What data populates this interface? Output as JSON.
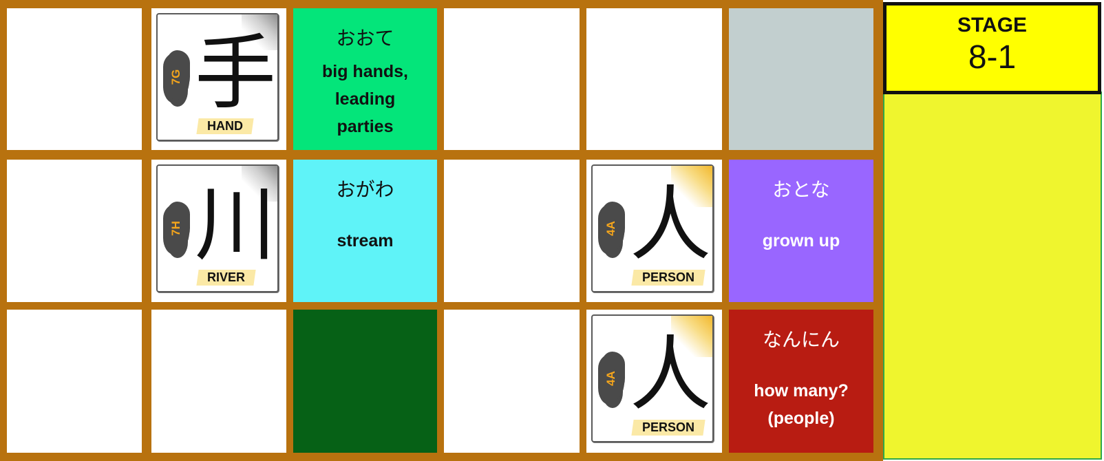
{
  "board": {
    "kanji_tiles": [
      {
        "glyph": "手",
        "code": "7G",
        "label": "HAND",
        "shine": "gray"
      },
      {
        "glyph": "川",
        "code": "7H",
        "label": "RIVER",
        "shine": "gray"
      },
      {
        "glyph": "人",
        "code": "4A",
        "label": "PERSON",
        "shine": "gold"
      },
      {
        "glyph": "人",
        "code": "4A",
        "label": "PERSON",
        "shine": "gold"
      }
    ],
    "word_cards": [
      {
        "kana": "おおて",
        "meaning_lines": [
          "big hands,",
          "leading",
          "parties"
        ],
        "color": "#04e57a"
      },
      {
        "kana": "おがわ",
        "meaning_lines": [
          "stream"
        ],
        "color": "#5ff3f8"
      },
      {
        "kana": "おとな",
        "meaning_lines": [
          "grown up"
        ],
        "color": "#9966ff"
      },
      {
        "kana": "なんにん",
        "meaning_lines": [
          "how many?",
          "(people)"
        ],
        "color": "#b81c12"
      }
    ],
    "colors": {
      "frame": "#b8720f",
      "empty_cell": "#ffffff",
      "gray_cell": "#c2cfcf",
      "dark_green_cell": "#066116"
    }
  },
  "stage": {
    "title": "STAGE",
    "number": "8-1",
    "header_color": "#ffff00",
    "panel_color": "#eff52e"
  }
}
